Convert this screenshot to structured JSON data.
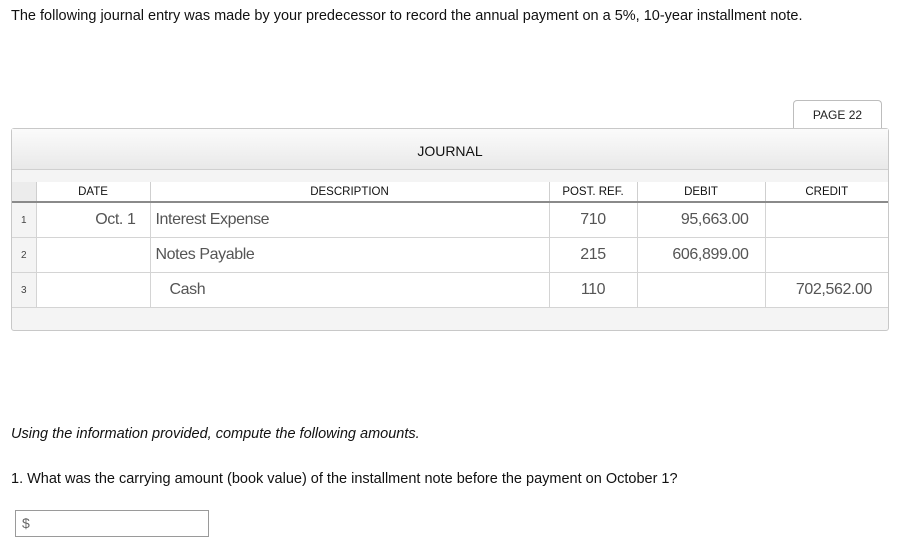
{
  "intro_text": "The following journal entry was made by your predecessor to record the annual payment on a 5%, 10-year installment note.",
  "page_label": "PAGE 22",
  "journal": {
    "title": "JOURNAL",
    "columns": {
      "date": "DATE",
      "description": "DESCRIPTION",
      "post_ref": "POST. REF.",
      "debit": "DEBIT",
      "credit": "CREDIT"
    },
    "rows": [
      {
        "num": "1",
        "date": "Oct. 1",
        "description": "Interest Expense",
        "post_ref": "710",
        "debit": "95,663.00",
        "credit": ""
      },
      {
        "num": "2",
        "date": "",
        "description": "Notes Payable",
        "post_ref": "215",
        "debit": "606,899.00",
        "credit": ""
      },
      {
        "num": "3",
        "date": "",
        "description": "Cash",
        "post_ref": "110",
        "debit": "",
        "credit": "702,562.00"
      }
    ]
  },
  "instructions": "Using the information provided, compute the following amounts.",
  "question_1": "1. What was the carrying amount (book value) of the installment note before the payment on October 1?",
  "answer_1": {
    "currency_symbol": "$",
    "value": ""
  }
}
